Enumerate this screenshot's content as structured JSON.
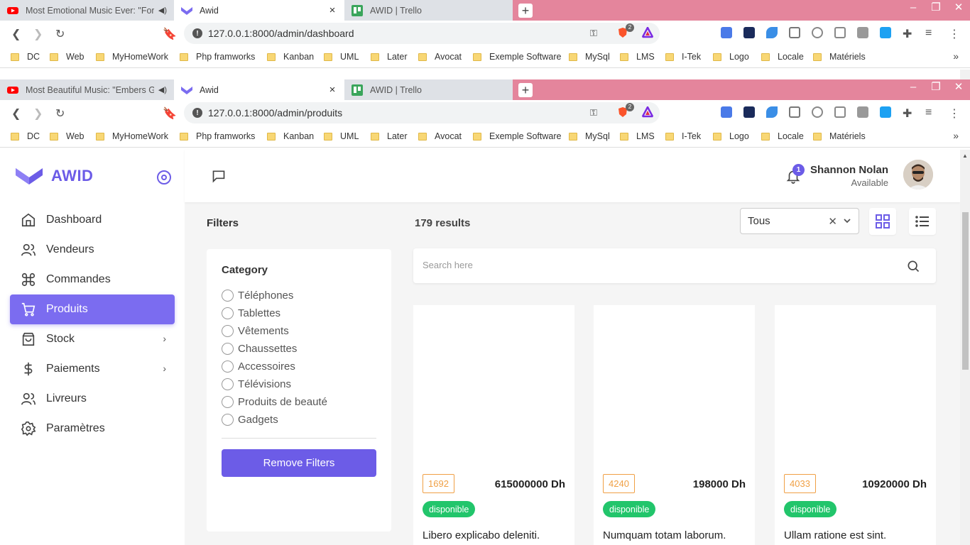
{
  "browser_windows": [
    {
      "tabs": [
        {
          "title": "Most Emotional Music Ever: \"Forev",
          "kind": "youtube"
        },
        {
          "title": "Awid",
          "kind": "awid"
        },
        {
          "title": "AWID | Trello",
          "kind": "trello"
        }
      ],
      "url": "127.0.0.1:8000/admin/dashboard"
    },
    {
      "tabs": [
        {
          "title": "Most Beautiful Music: \"Embers Glo",
          "kind": "youtube"
        },
        {
          "title": "Awid",
          "kind": "awid"
        },
        {
          "title": "AWID | Trello",
          "kind": "trello"
        }
      ],
      "url": "127.0.0.1:8000/admin/produits"
    }
  ],
  "bookmarks": [
    "DC",
    "Web",
    "MyHomeWork",
    "Php framworks",
    "Kanban",
    "UML",
    "Later",
    "Avocat",
    "Exemple Software",
    "MySql",
    "LMS",
    "I-Tek",
    "Logo",
    "Locale",
    "Matériels"
  ],
  "brave_badge": "2",
  "app": {
    "logo_text": "AWID",
    "menu": [
      {
        "label": "Dashboard",
        "icon": "home-icon",
        "active": false,
        "has_chevron": false
      },
      {
        "label": "Vendeurs",
        "icon": "users-icon",
        "active": false,
        "has_chevron": false
      },
      {
        "label": "Commandes",
        "icon": "command-icon",
        "active": false,
        "has_chevron": false
      },
      {
        "label": "Produits",
        "icon": "cart-icon",
        "active": true,
        "has_chevron": false
      },
      {
        "label": "Stock",
        "icon": "shopping-bag-icon",
        "active": false,
        "has_chevron": true
      },
      {
        "label": "Paiements",
        "icon": "dollar-icon",
        "active": false,
        "has_chevron": true
      },
      {
        "label": "Livreurs",
        "icon": "users-icon",
        "active": false,
        "has_chevron": false
      },
      {
        "label": "Paramètres",
        "icon": "settings-icon",
        "active": false,
        "has_chevron": false
      }
    ],
    "user": {
      "name": "Shannon Nolan",
      "status": "Available"
    },
    "notifications_count": "1",
    "filters_title": "Filters",
    "results_text": "179 results",
    "sort_select": {
      "value": "Tous"
    },
    "category": {
      "title": "Category",
      "options": [
        "Téléphones",
        "Tablettes",
        "Vêtements",
        "Chaussettes",
        "Accessoires",
        "Télévisions",
        "Produits de beauté",
        "Gadgets"
      ]
    },
    "remove_filters_label": "Remove Filters",
    "search_placeholder": "Search here",
    "products": [
      {
        "stock": "1692",
        "price": "615000000 Dh",
        "status": "disponible",
        "name": "Libero explicabo deleniti."
      },
      {
        "stock": "4240",
        "price": "198000 Dh",
        "status": "disponible",
        "name": "Numquam totam laborum."
      },
      {
        "stock": "4033",
        "price": "10920000 Dh",
        "status": "disponible",
        "name": "Ullam ratione est sint."
      }
    ]
  },
  "colors": {
    "accent": "#6c5ce7",
    "success": "#22c56b",
    "stock_border": "#f0a045",
    "titlebar": "#e4859c"
  }
}
